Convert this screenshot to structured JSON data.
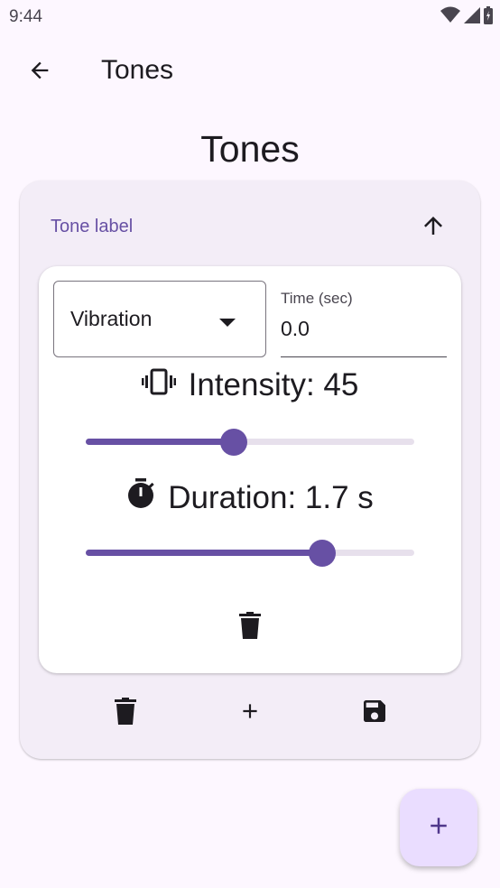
{
  "status_bar": {
    "time": "9:44",
    "icons": [
      "wifi-icon",
      "cellular-icon",
      "battery-icon"
    ]
  },
  "app_bar": {
    "title": "Tones",
    "back_icon": "arrow-back-icon"
  },
  "page": {
    "title": "Tones"
  },
  "tone_card": {
    "label": "Tone label",
    "collapse_icon": "arrow-up-icon",
    "step": {
      "type_select": {
        "value": "Vibration",
        "icon": "dropdown-arrow-icon"
      },
      "time_field": {
        "label": "Time (sec)",
        "value": "0.0"
      },
      "intensity": {
        "text": "Intensity: 45",
        "icon": "vibration-icon",
        "value": 45,
        "fraction": 0.45
      },
      "duration": {
        "text": "Duration: 1.7 s",
        "icon": "timer-icon",
        "value": 1.7,
        "fraction": 0.72
      },
      "delete_icon": "delete-icon"
    },
    "actions": {
      "delete_icon": "delete-icon",
      "add_icon": "add-icon",
      "save_icon": "save-icon"
    }
  },
  "fab": {
    "icon": "add-icon"
  },
  "colors": {
    "primary": "#6750a4",
    "background": "#fdf7ff",
    "card": "#f3edf7",
    "fab": "#eaddff",
    "track": "#e7e0ec"
  }
}
